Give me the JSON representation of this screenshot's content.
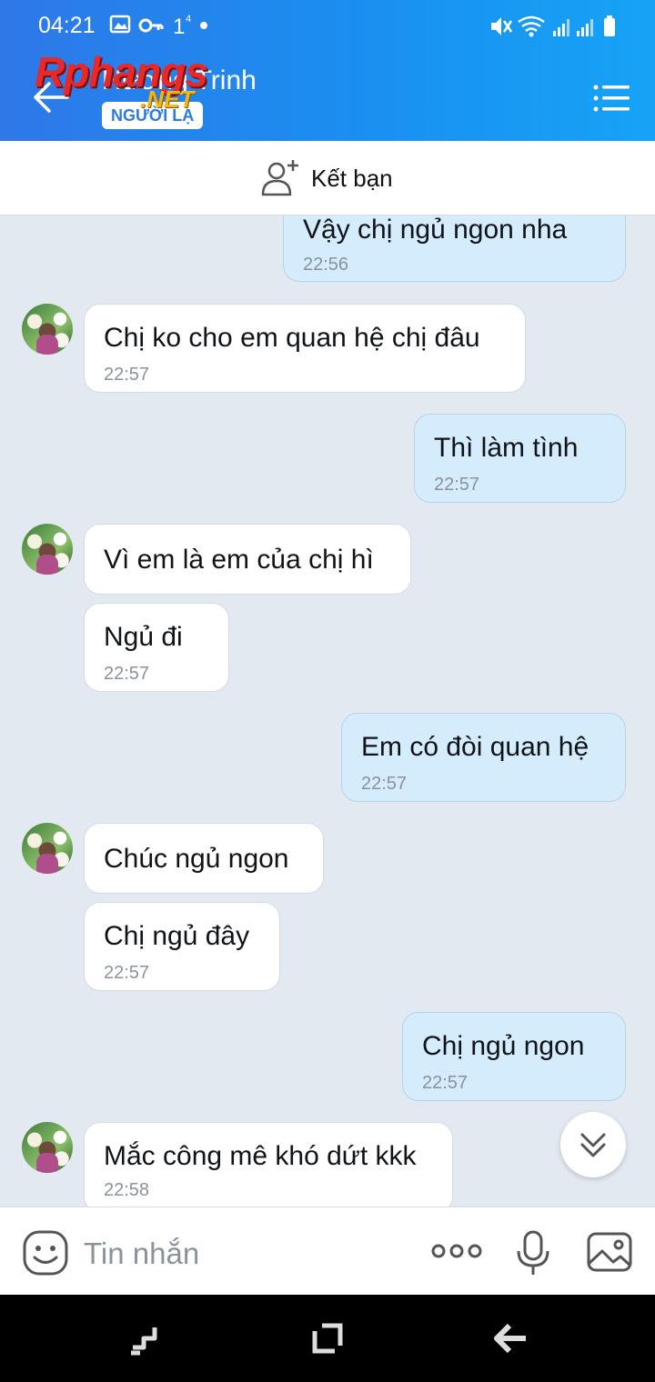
{
  "status_bar": {
    "time": "04:21",
    "left_icons": [
      "image-icon",
      "key-icon",
      "sync-icon",
      "dot-icon"
    ],
    "right_icons": [
      "mute-icon",
      "wifi-icon",
      "signal-icon",
      "signal-icon",
      "battery-icon"
    ]
  },
  "header": {
    "back_icon": "arrow-left-icon",
    "title": "Hương Trinh",
    "badge": "NGƯỜI LẠ",
    "menu_icon": "list-menu-icon",
    "watermark": {
      "text1": "Rphangs",
      "text2": ".NET"
    },
    "colors": {
      "gradient_start": "#2e78e8",
      "gradient_end": "#16a3f6"
    }
  },
  "friend_bar": {
    "icon": "add-user-icon",
    "label": "Kết bạn"
  },
  "messages": [
    {
      "side": "out",
      "text": "Vậy  chị  ngủ  ngon nha",
      "time": "22:56"
    },
    {
      "side": "in",
      "text": "Chị ko cho em quan hệ chị đâu",
      "time": "22:57",
      "avatar": true
    },
    {
      "side": "out",
      "text": "Thì  làm  tình",
      "time": "22:57"
    },
    {
      "side": "in",
      "text": "Vì em là em của chị hì",
      "time": "",
      "avatar": true
    },
    {
      "side": "in",
      "text": "Ngủ đi",
      "time": "22:57"
    },
    {
      "side": "out",
      "text": "Em có đòi quan hệ",
      "time": "22:57"
    },
    {
      "side": "in",
      "text": "Chúc ngủ ngon",
      "time": "",
      "avatar": true
    },
    {
      "side": "in",
      "text": "Chị ngủ đây",
      "time": "22:57"
    },
    {
      "side": "out",
      "text": "Chị  ngủ ngon",
      "time": "22:57"
    },
    {
      "side": "in",
      "text": "Mắc công mê khó dứt kkk",
      "time": "22:58",
      "avatar": true
    }
  ],
  "scroll_down_icon": "double-chevron-down-icon",
  "input_bar": {
    "emoji_icon": "emoji-icon",
    "placeholder": "Tin nhắn",
    "more_icon": "more-dots-icon",
    "mic_icon": "microphone-icon",
    "image_icon": "image-icon"
  },
  "colors": {
    "incoming_bubble": "#ffffff",
    "outgoing_bubble": "#d5ecfc",
    "chat_background": "#e2e9f1"
  }
}
